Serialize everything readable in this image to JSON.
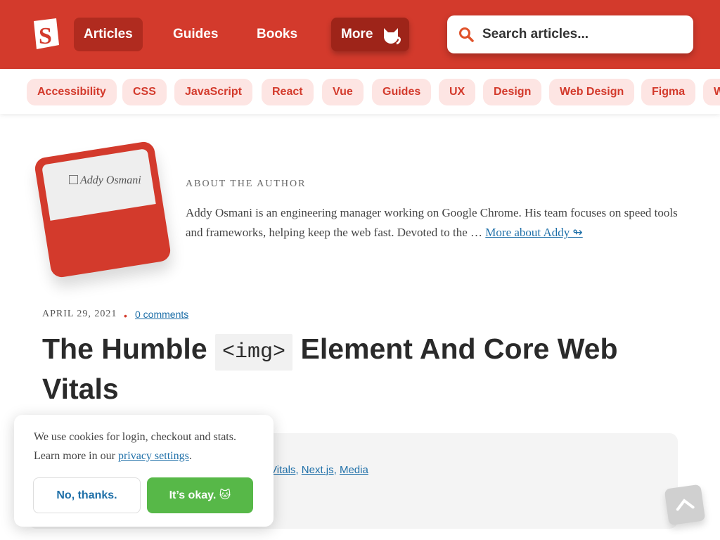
{
  "header": {
    "logo_letter": "S",
    "nav": [
      {
        "label": "Articles"
      },
      {
        "label": "Guides"
      },
      {
        "label": "Books"
      },
      {
        "label": "More"
      }
    ],
    "search_placeholder": "Search articles..."
  },
  "tags": [
    "Accessibility",
    "CSS",
    "JavaScript",
    "React",
    "Vue",
    "Guides",
    "UX",
    "Design",
    "Web Design",
    "Figma",
    "W"
  ],
  "author": {
    "photo_alt": "Addy Osmani",
    "label": "ABOUT THE AUTHOR",
    "bio": "Addy Osmani is an engineering manager working on Google Chrome. His team focuses on speed tools and frameworks, helping keep the web fast. Devoted to the …",
    "more_link": "More about Addy ↬"
  },
  "article": {
    "date": "APRIL 29, 2021",
    "comments": "0 comments",
    "title_before": "The Humble",
    "title_code": "<img>",
    "title_after": "Element And Core Web Vitals",
    "tag_links": [
      "Vitals",
      "Next.js",
      "Media"
    ]
  },
  "cookie": {
    "text": "We use cookies for login, checkout and stats. Learn more in our",
    "link": "privacy settings",
    "period": ".",
    "decline": "No, thanks.",
    "accept": "It’s okay. 🐱"
  },
  "colors": {
    "brand": "#d33a2c",
    "link": "#1e6fa8",
    "accept": "#57b848"
  }
}
